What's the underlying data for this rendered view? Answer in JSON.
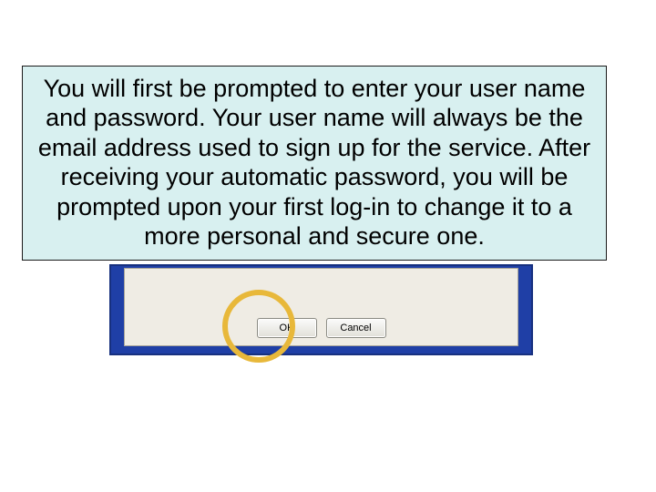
{
  "callout": {
    "text": "You will first be prompted to enter your user name and password.  Your user name will always be the email address used to sign up for the service.  After receiving your automatic password, you will be prompted upon your first log-in to change it to a more personal and secure one."
  },
  "dialog": {
    "ok_label": "OK",
    "cancel_label": "Cancel"
  },
  "colors": {
    "callout_bg": "#d8f0f0",
    "panel_blue": "#1f3fa6",
    "ring": "#e8b83a"
  }
}
